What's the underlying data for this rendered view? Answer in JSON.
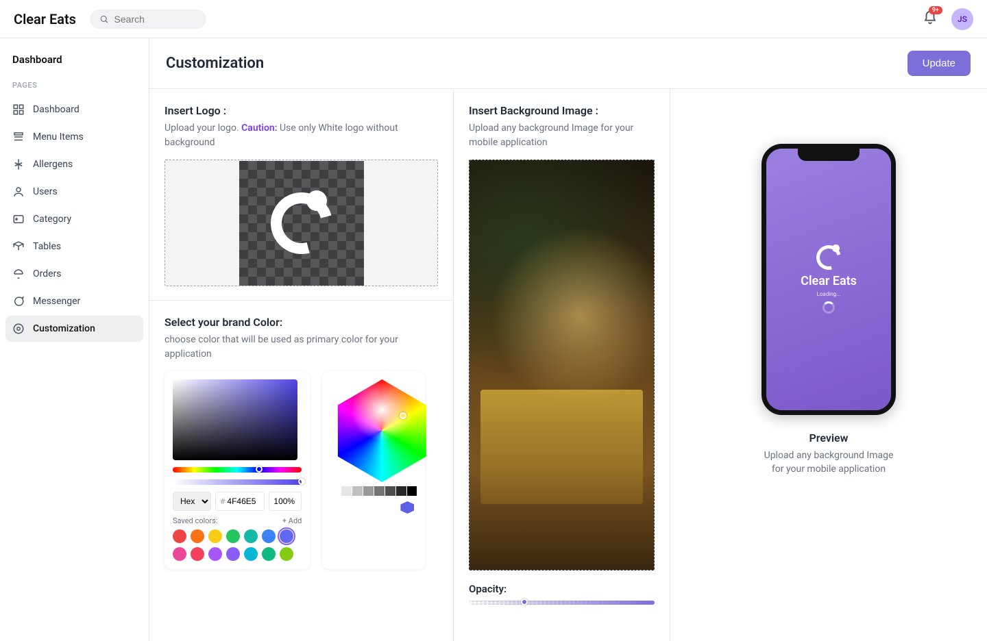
{
  "brand": "Clear Eats",
  "search": {
    "placeholder": "Search"
  },
  "notifications": {
    "badge": "9+"
  },
  "avatar": {
    "initials": "JS"
  },
  "sidebar": {
    "title": "Dashboard",
    "section": "PAGES",
    "items": [
      {
        "label": "Dashboard",
        "icon": "dashboard-icon"
      },
      {
        "label": "Menu Items",
        "icon": "menu-icon"
      },
      {
        "label": "Allergens",
        "icon": "allergen-icon"
      },
      {
        "label": "Users",
        "icon": "user-icon"
      },
      {
        "label": "Category",
        "icon": "category-icon"
      },
      {
        "label": "Tables",
        "icon": "table-icon"
      },
      {
        "label": "Orders",
        "icon": "orders-icon"
      },
      {
        "label": "Messenger",
        "icon": "messenger-icon"
      },
      {
        "label": "Customization",
        "icon": "customization-icon"
      }
    ]
  },
  "page": {
    "title": "Customization",
    "update_btn": "Update"
  },
  "logo": {
    "title": "Insert Logo :",
    "desc_before": "Upload your logo. ",
    "caution": "Caution:",
    "desc_after": " Use only White logo without background"
  },
  "brandColor": {
    "title": "Select your brand Color:",
    "desc": "choose color that will be used as primary color for your application",
    "format": "Hex",
    "hex": "4F46E5",
    "alpha": "100%",
    "saved_label": "Saved colors:",
    "add_label": "+ Add",
    "swatches": [
      "#ef4444",
      "#f97316",
      "#facc15",
      "#22c55e",
      "#14b8a6",
      "#3b82f6",
      "#6366f1",
      "#ec4899",
      "#f43f5e",
      "#a855f7",
      "#8b5cf6",
      "#06b6d4",
      "#10b981",
      "#84cc16"
    ]
  },
  "bg": {
    "title": "Insert Background Image :",
    "desc": "Upload any background Image for your mobile application",
    "opacity_label": "Opacity:"
  },
  "preview": {
    "brand": "Clear Eats",
    "loading": "Loading...",
    "title": "Preview",
    "desc": "Upload any background Image for your mobile application"
  }
}
